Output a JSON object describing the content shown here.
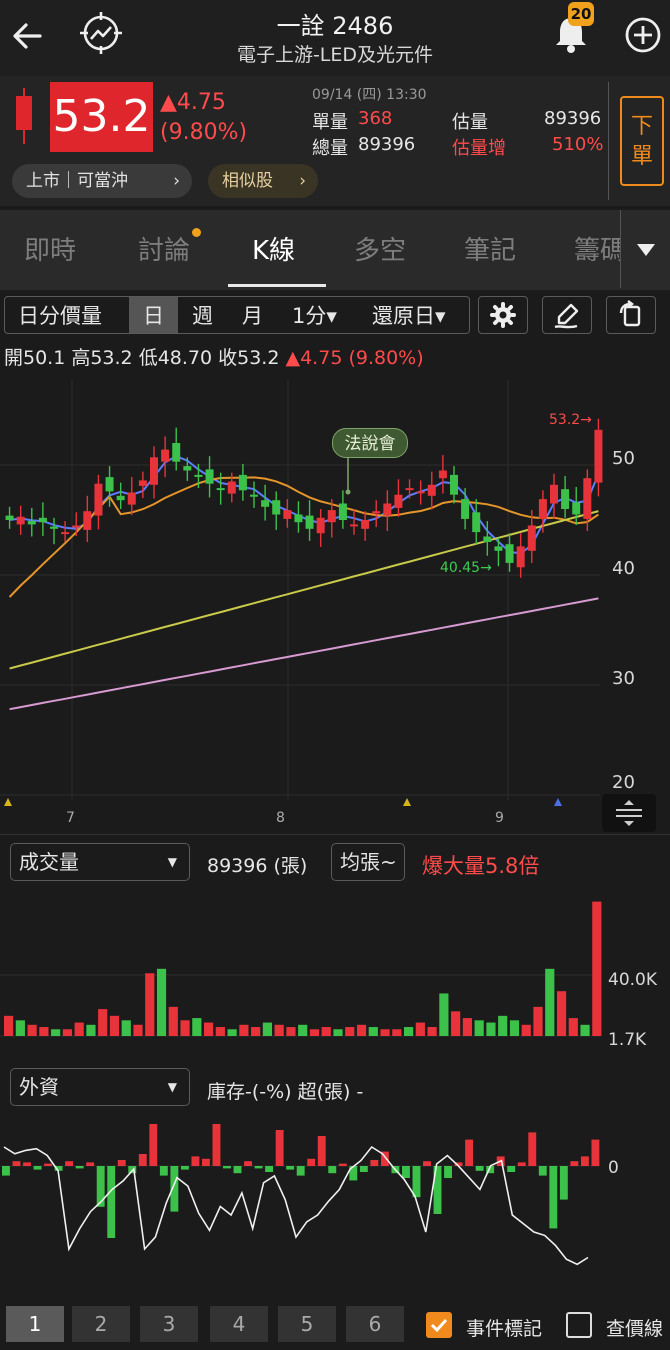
{
  "header": {
    "title": "一詮 2486",
    "subtitle": "電子上游-LED及光元件",
    "notification_count": "20"
  },
  "quote": {
    "price": "53.2",
    "change": "▲4.75",
    "change_pct": "(9.80%)",
    "datetime": "09/14 (四) 13:30",
    "unit_vol_label": "單量",
    "unit_vol_value": "368",
    "est_vol_label": "估量",
    "est_vol_value": "89396",
    "total_vol_label": "總量",
    "total_vol_value": "89396",
    "est_inc_label": "估量增",
    "est_inc_value": "510%",
    "sell_label": "下\n單",
    "sell_1": "下",
    "sell_2": "單",
    "tag_market": "上市｜可當沖",
    "tag_similar": "相似股"
  },
  "tabs": [
    "即時",
    "討論",
    "K線",
    "多空",
    "筆記",
    "籌碼"
  ],
  "toolbar": {
    "items": [
      "日分價量",
      "日",
      "週",
      "月",
      "1分▾",
      "還原日▾"
    ],
    "active": "日"
  },
  "ohlc": {
    "text": "開50.1 高53.2 低48.70 收53.2",
    "change": "▲4.75 (9.80%)"
  },
  "main_chart": {
    "type": "candlestick",
    "y_ticks": [
      "50",
      "40",
      "30",
      "20"
    ],
    "x_ticks": [
      "7",
      "8",
      "9"
    ],
    "annotation_event": "法說會",
    "annotation_high": "53.2→",
    "annotation_low": "40.45→"
  },
  "volume_panel": {
    "selector": "成交量",
    "value": "89396 (張)",
    "avg_selector": "均張~",
    "alert": "爆大量5.8倍",
    "y_ticks": [
      "40.0K",
      "1.7K"
    ]
  },
  "foreign_panel": {
    "selector": "外資",
    "value": "庫存-(-%) 超(張) -",
    "y_tick": "0"
  },
  "bottom": {
    "pages": [
      "1",
      "2",
      "3",
      "4",
      "5",
      "6"
    ],
    "active_page": "1",
    "event_mark": "事件標記",
    "price_line": "查價線"
  },
  "chart_data": {
    "type": "bar",
    "title": "",
    "volume": [
      18,
      14,
      10,
      8,
      6,
      6,
      12,
      10,
      24,
      18,
      14,
      10,
      56,
      60,
      26,
      14,
      16,
      12,
      8,
      6,
      10,
      8,
      12,
      10,
      8,
      10,
      6,
      8,
      6,
      8,
      10,
      8,
      6,
      6,
      8,
      12,
      8,
      38,
      22,
      16,
      14,
      12,
      18,
      14,
      10,
      26,
      60,
      40,
      16,
      10,
      120
    ],
    "foreign": [
      -8,
      4,
      3,
      -3,
      2,
      -4,
      4,
      -2,
      3,
      -34,
      -60,
      5,
      -6,
      10,
      35,
      -8,
      -38,
      -3,
      8,
      6,
      35,
      -2,
      -6,
      4,
      -2,
      -5,
      30,
      -3,
      -8,
      6,
      25,
      -6,
      2,
      -12,
      -5,
      5,
      12,
      -6,
      -10,
      -26,
      4,
      -40,
      -10,
      3,
      22,
      -4,
      -6,
      8,
      -5,
      3,
      28,
      -8,
      -52,
      -28,
      4,
      8,
      22
    ]
  }
}
